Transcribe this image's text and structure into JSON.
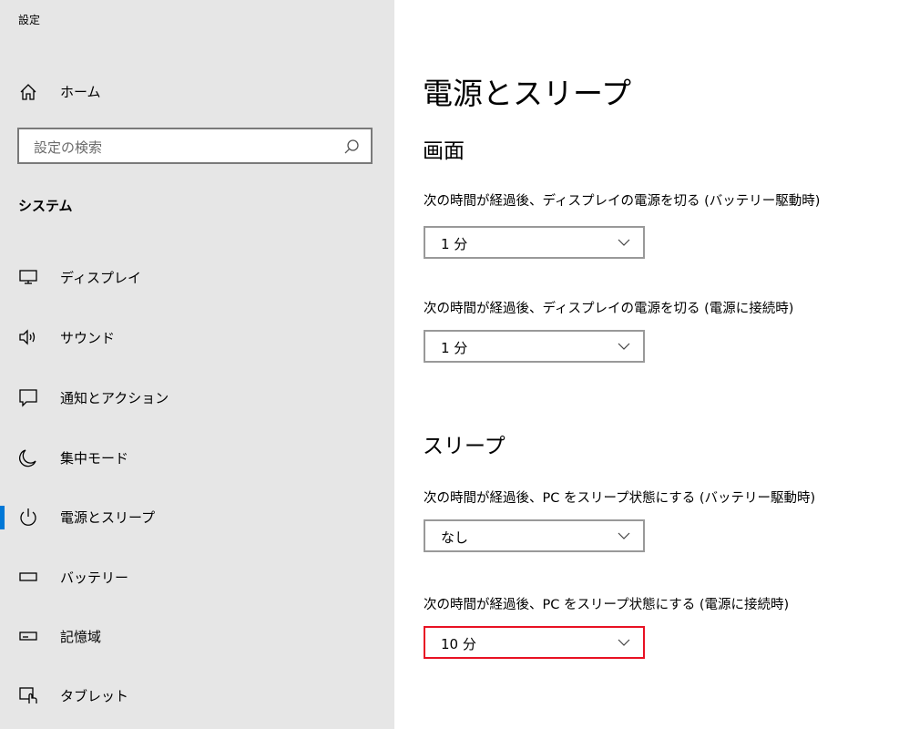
{
  "app": {
    "title": "設定"
  },
  "sidebar": {
    "home_label": "ホーム",
    "search_placeholder": "設定の検索",
    "section_label": "システム",
    "items": [
      {
        "label": "ディスプレイ",
        "icon": "monitor-icon"
      },
      {
        "label": "サウンド",
        "icon": "speaker-icon"
      },
      {
        "label": "通知とアクション",
        "icon": "notification-icon"
      },
      {
        "label": "集中モード",
        "icon": "moon-icon"
      },
      {
        "label": "電源とスリープ",
        "icon": "power-icon",
        "selected": true
      },
      {
        "label": "バッテリー",
        "icon": "battery-icon"
      },
      {
        "label": "記憶域",
        "icon": "storage-icon"
      },
      {
        "label": "タブレット",
        "icon": "tablet-icon"
      }
    ]
  },
  "main": {
    "title": "電源とスリープ",
    "screen": {
      "heading": "画面",
      "battery_label": "次の時間が経過後、ディスプレイの電源を切る (バッテリー駆動時)",
      "battery_value": "1 分",
      "plugged_label": "次の時間が経過後、ディスプレイの電源を切る (電源に接続時)",
      "plugged_value": "1 分"
    },
    "sleep": {
      "heading": "スリープ",
      "battery_label": "次の時間が経過後、PC をスリープ状態にする (バッテリー駆動時)",
      "battery_value": "なし",
      "plugged_label": "次の時間が経過後、PC をスリープ状態にする (電源に接続時)",
      "plugged_value": "10 分"
    }
  },
  "colors": {
    "accent": "#0078d7",
    "highlight": "#e81123",
    "sidebar_bg": "#e6e6e6"
  }
}
